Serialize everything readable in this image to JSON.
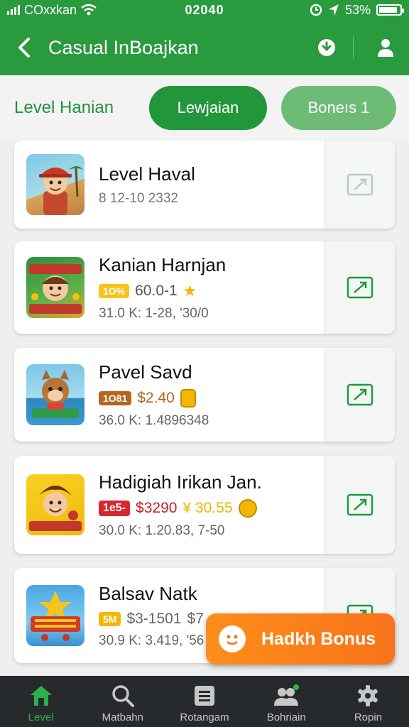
{
  "status_bar": {
    "carrier": "COxxkan",
    "time": "02040",
    "battery": "53%",
    "battery_level": 0.9
  },
  "header": {
    "title": "Casual InBoajkan"
  },
  "section": {
    "title": "Level Hanian"
  },
  "tabs": [
    {
      "label": "Lewjaian",
      "active": true
    },
    {
      "label": "Boneıs 1",
      "active": false
    }
  ],
  "cards": [
    {
      "title": "Level Haval",
      "badge": "",
      "price": "",
      "price_extra": "",
      "stats": "8    12-10 2332",
      "enabled": false
    },
    {
      "title": "Kanian Harnjan",
      "badge": "1O%",
      "price": "60.0-1",
      "price_extra": "",
      "stats": "31.0 K: 1-28, '30/0",
      "enabled": true
    },
    {
      "title": "Pavel Savd",
      "badge": "1O81",
      "price": "$2.40",
      "price_extra": "",
      "stats": "36.0 K: 1.4896348",
      "enabled": true
    },
    {
      "title": "Hadigiah Irikan Jan.",
      "badge": "1e5-",
      "price": "$3290",
      "price_extra": "¥ 30.55",
      "stats": "30.0 K: 1.20.83, 7-50",
      "enabled": true
    },
    {
      "title": "Balsav Natk",
      "badge": "5M",
      "price": "$3-1501",
      "price_extra": "$7",
      "stats": "30.9 K: 3.419, '56",
      "enabled": true
    }
  ],
  "fab": {
    "label": "Hadkh Bonus"
  },
  "bottom_nav": [
    {
      "label": "Level",
      "icon": "home-icon",
      "active": true
    },
    {
      "label": "Matbahn",
      "icon": "search-icon",
      "active": false
    },
    {
      "label": "Rotangam",
      "icon": "list-icon",
      "active": false
    },
    {
      "label": "Bohriain",
      "icon": "people-icon",
      "active": false
    },
    {
      "label": "Ropin",
      "icon": "gear-icon",
      "active": false
    }
  ],
  "colors": {
    "primary": "#2a9a3e",
    "accent": "#f8731a",
    "nav_bg": "#262a2c"
  }
}
